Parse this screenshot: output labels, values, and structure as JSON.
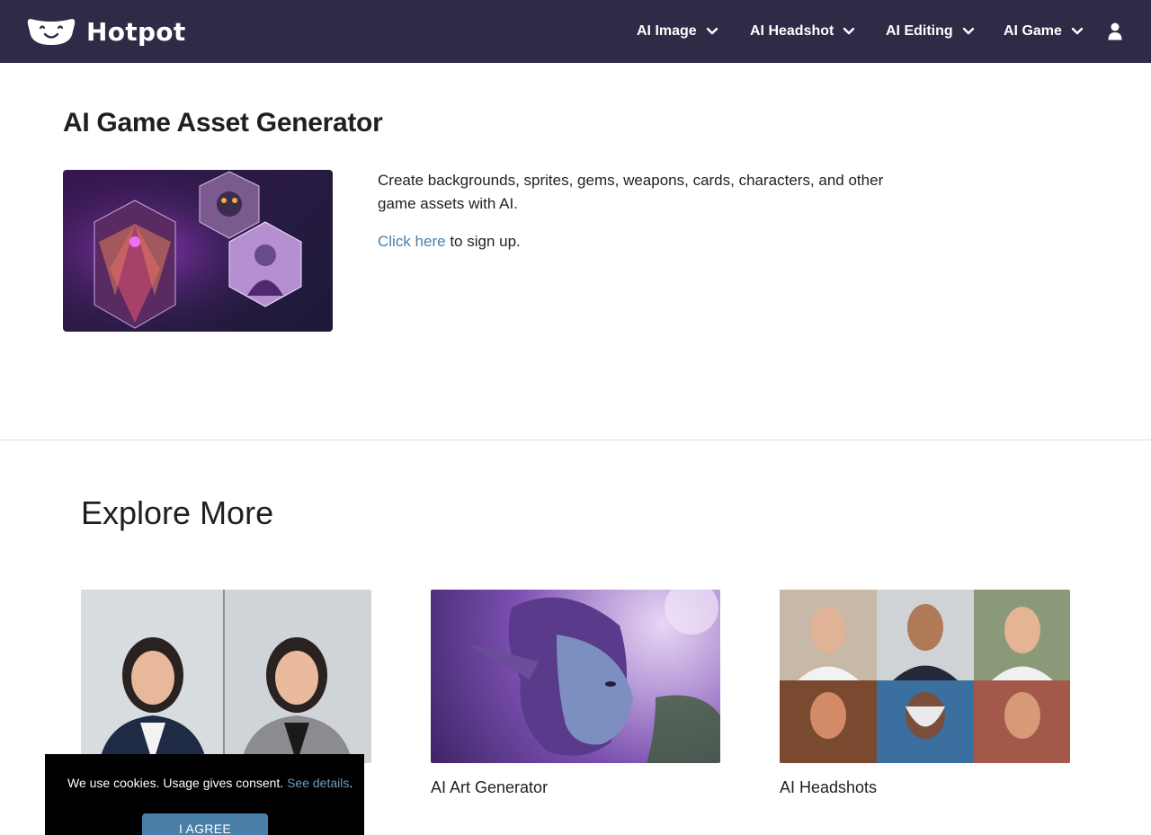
{
  "header": {
    "brand": "Hotpot",
    "nav": [
      {
        "label": "AI Image"
      },
      {
        "label": "AI Headshot"
      },
      {
        "label": "AI Editing"
      },
      {
        "label": "AI Game"
      }
    ],
    "icons": {
      "logo": "hotpot-face-logo",
      "chevron": "chevron-down-icon",
      "user": "user-icon"
    }
  },
  "hero": {
    "title": "AI Game Asset Generator",
    "description": "Create backgrounds, sprites, gems, weapons, cards, characters, and other game assets with AI.",
    "signup_link": "Click here",
    "signup_rest": " to sign up."
  },
  "explore": {
    "title": "Explore More",
    "cards": [
      {
        "label": ""
      },
      {
        "label": "AI Art Generator"
      },
      {
        "label": "AI Headshots"
      }
    ]
  },
  "cookie": {
    "text": "We use cookies. Usage gives consent. ",
    "link": "See details",
    "period": ".",
    "button": "I AGREE"
  },
  "colors": {
    "header_bg": "#2f2a45",
    "link": "#4a7fa8",
    "cookie_bg": "#000000"
  }
}
